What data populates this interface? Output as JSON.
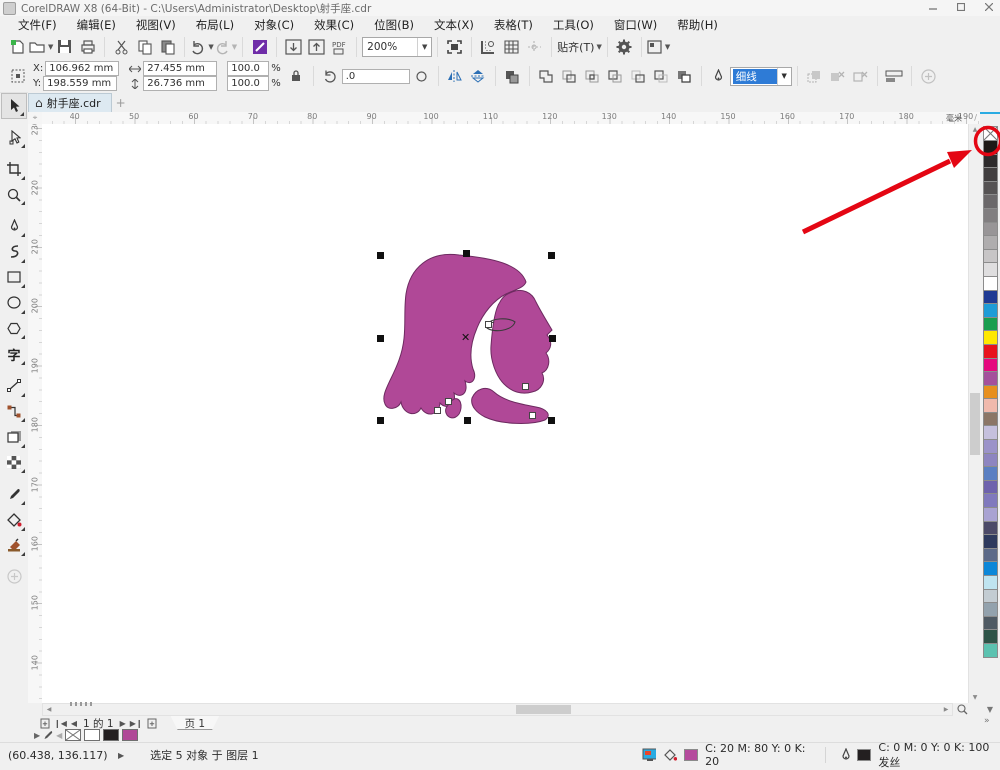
{
  "window": {
    "title": "CorelDRAW X8 (64-Bit) - C:\\Users\\Administrator\\Desktop\\射手座.cdr"
  },
  "menu": {
    "items": [
      "文件(F)",
      "编辑(E)",
      "视图(V)",
      "布局(L)",
      "对象(C)",
      "效果(C)",
      "位图(B)",
      "文本(X)",
      "表格(T)",
      "工具(O)",
      "窗口(W)",
      "帮助(H)"
    ]
  },
  "std_toolbar": {
    "zoom_level": "200%",
    "snap_label": "贴齐(T)"
  },
  "property_bar": {
    "x_label": "X:",
    "y_label": "Y:",
    "x": "106.962 mm",
    "y": "198.559 mm",
    "w": "27.455 mm",
    "h": "26.736 mm",
    "scale_x": "100.0",
    "scale_y": "100.0",
    "pct": "%",
    "rotation": ".0",
    "outline_width": "细线"
  },
  "doc_tab": {
    "title": "射手座.cdr",
    "new_tab": "+",
    "home": "⌂"
  },
  "rulers": {
    "h_ticks": [
      "40",
      "50",
      "60",
      "70",
      "80",
      "90",
      "100",
      "110",
      "120",
      "130",
      "140",
      "150",
      "160",
      "170",
      "180",
      "190"
    ],
    "v_ticks": [
      "230",
      "220",
      "210",
      "200",
      "190",
      "180",
      "170",
      "160",
      "150",
      "140"
    ],
    "unit": "毫米"
  },
  "canvas": {
    "figure_fill": "#b04897",
    "figure_outline": "#6d2a60"
  },
  "palette": {
    "colors": [
      "#1f1a17",
      "#2d2a2b",
      "#413e3f",
      "#565354",
      "#6b686a",
      "#817e80",
      "#989597",
      "#afadae",
      "#c7c5c6",
      "#dfdedf",
      "#ffffff",
      "#1f3a93",
      "#1e9cd7",
      "#199e4f",
      "#ffe800",
      "#e8131d",
      "#e5087e",
      "#a4509c",
      "#e78f1e",
      "#f0b9ac",
      "#8b7666",
      "#c5c0dd",
      "#9b93c9",
      "#8d85c0",
      "#5a7fc2",
      "#6e62ad",
      "#8079bd",
      "#a9a3d2",
      "#4c4a68",
      "#2e3a5e",
      "#5c6a88",
      "#0c87d8",
      "#bfe4f0",
      "#c3ccd2",
      "#93a2ad",
      "#4f5a63",
      "#2e5448",
      "#5cc2b0"
    ]
  },
  "navigator": {
    "page_info": "1 的 1",
    "page_tab": "页 1"
  },
  "doc_palette": {
    "white": "#ffffff",
    "black": "#231f20",
    "magenta": "#b04897"
  },
  "status_bar": {
    "coords": "(60.438, 136.117)",
    "selection": "选定 5 对象 于 图层 1",
    "fill_text": "C: 20 M: 80 Y: 0 K: 20",
    "fill_color": "#b54a9d",
    "outline_text": "C: 0 M: 0 Y: 0 K: 100 发丝",
    "outline_color": "#231f20"
  },
  "annotation": {
    "color": "#e40613"
  }
}
